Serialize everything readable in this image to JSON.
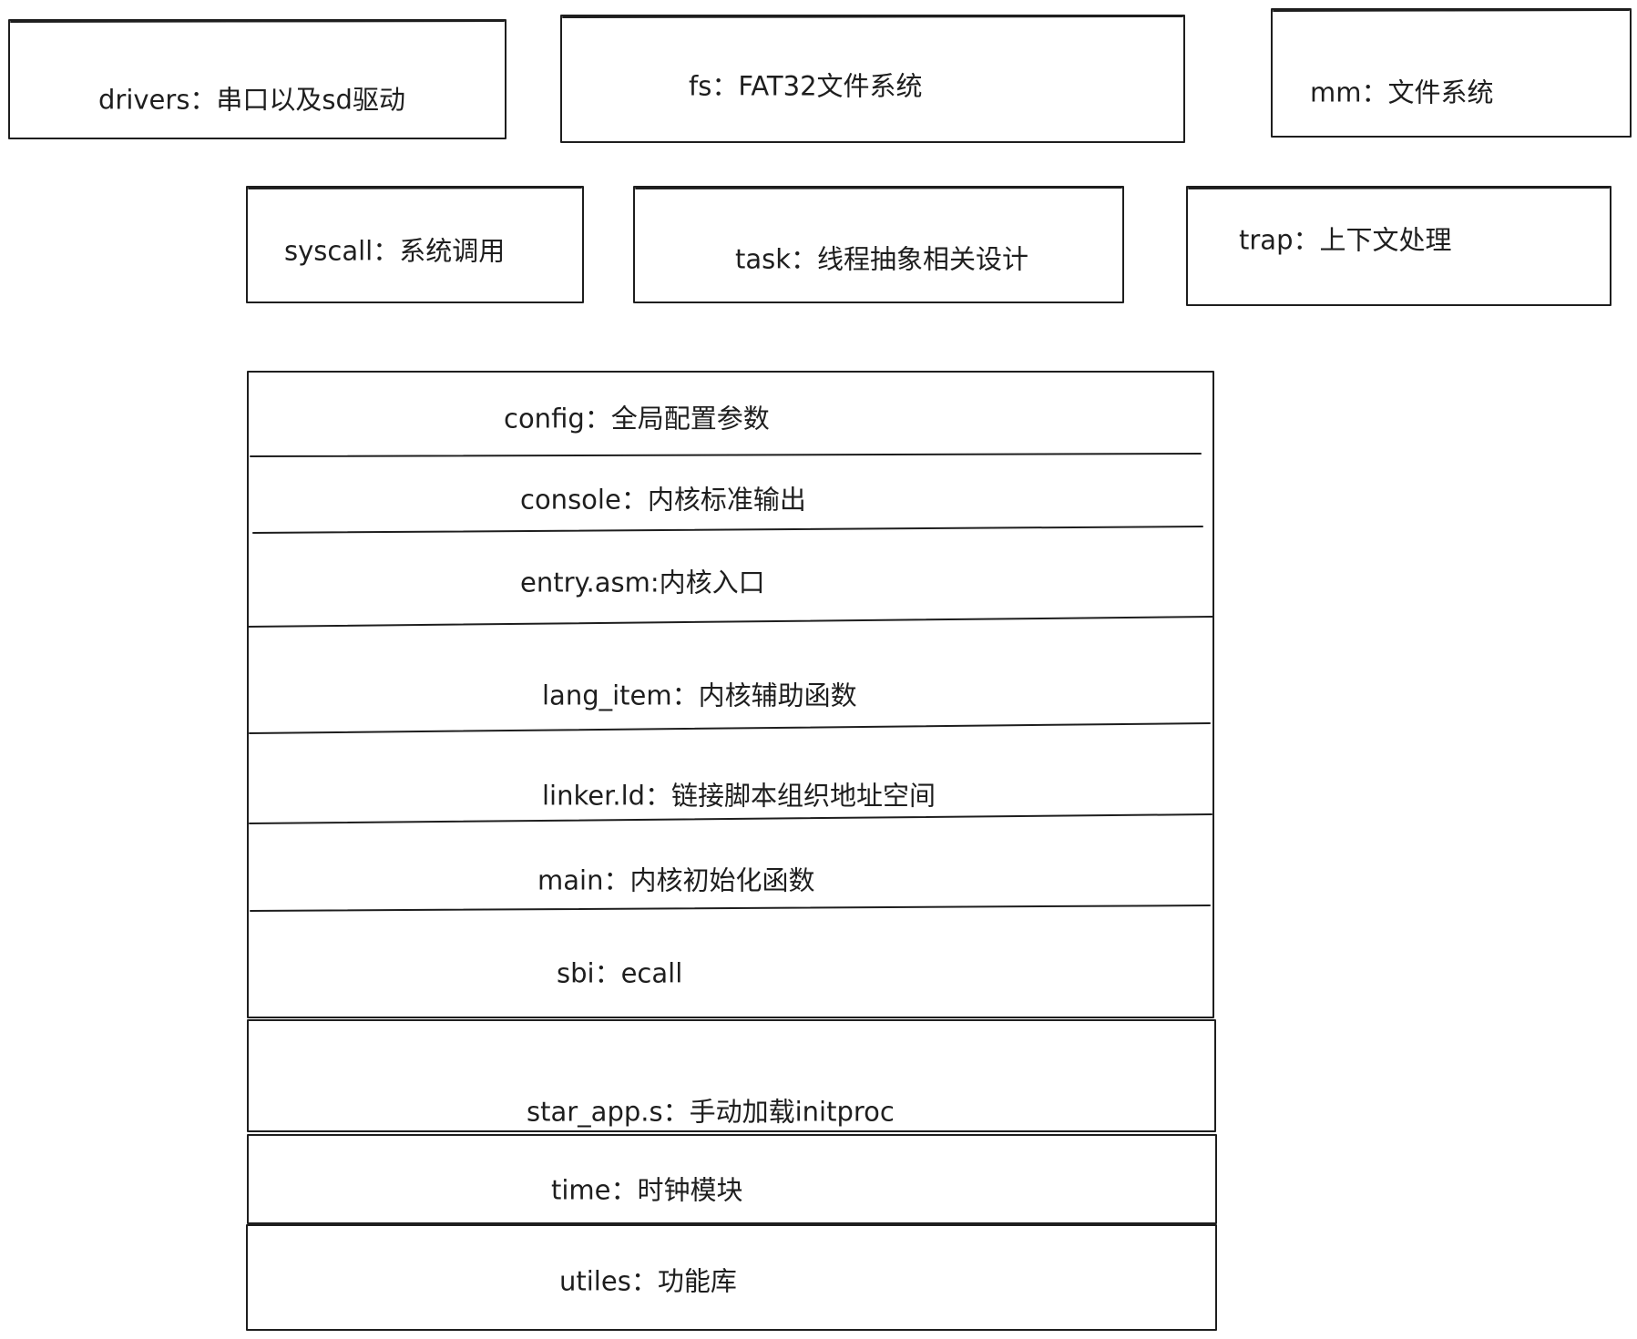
{
  "modules": {
    "drivers": "drivers：串口以及sd驱动",
    "fs": "fs：FAT32文件系统",
    "mm": "mm：文件系统",
    "syscall": "syscall：系统调用",
    "task": "task：线程抽象相关设计",
    "trap": "trap：上下文处理"
  },
  "files": {
    "config": "config：全局配置参数",
    "console": "console：内核标准输出",
    "entry": "entry.asm:内核入口",
    "lang_item": "lang_item：内核辅助函数",
    "linker": "linker.ld：链接脚本组织地址空间",
    "main": "main：内核初始化函数",
    "sbi": "sbi：ecall",
    "star_app": "star_app.s：手动加载initproc",
    "time": "time：时钟模块",
    "utiles": "utiles：功能库"
  },
  "colors": {
    "stroke": "#1e1e1e",
    "background": "#ffffff"
  }
}
